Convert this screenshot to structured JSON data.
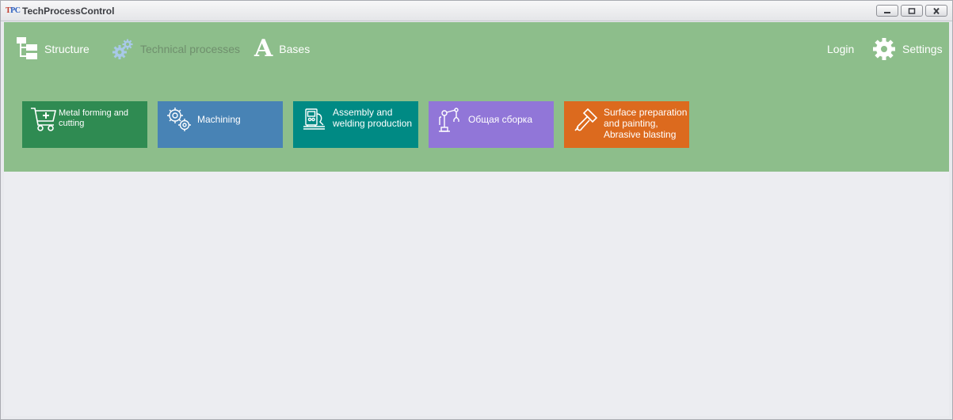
{
  "window": {
    "title": "TechProcessControl",
    "logo_text_t": "T",
    "logo_text_p": "PC",
    "buttons": [
      "minimize-icon",
      "maximize-icon",
      "close-icon"
    ]
  },
  "nav": {
    "structure_label": "Structure",
    "technical_processes_label": "Technical processes",
    "bases_label": "Bases",
    "login_label": "Login",
    "settings_label": "Settings"
  },
  "tiles": [
    {
      "label": "Metal forming and cutting",
      "icon": "cart-plus-icon",
      "color": "#2f8b52"
    },
    {
      "label": "Machining",
      "icon": "gears-icon",
      "color": "#4883b5"
    },
    {
      "label": "Assembly and welding production",
      "icon": "welding-machine-icon",
      "color": "#008a84"
    },
    {
      "label": "Общая сборка",
      "icon": "robot-arm-icon",
      "color": "#9176d8"
    },
    {
      "label": "Surface preparation and painting, Abrasive blasting",
      "icon": "paint-brush-icon",
      "color": "#dc6a1e"
    }
  ],
  "colors": {
    "header_bg": "#8dbe8b",
    "content_bg": "#ecedf1",
    "disabled_text": "#6f8f6d"
  }
}
